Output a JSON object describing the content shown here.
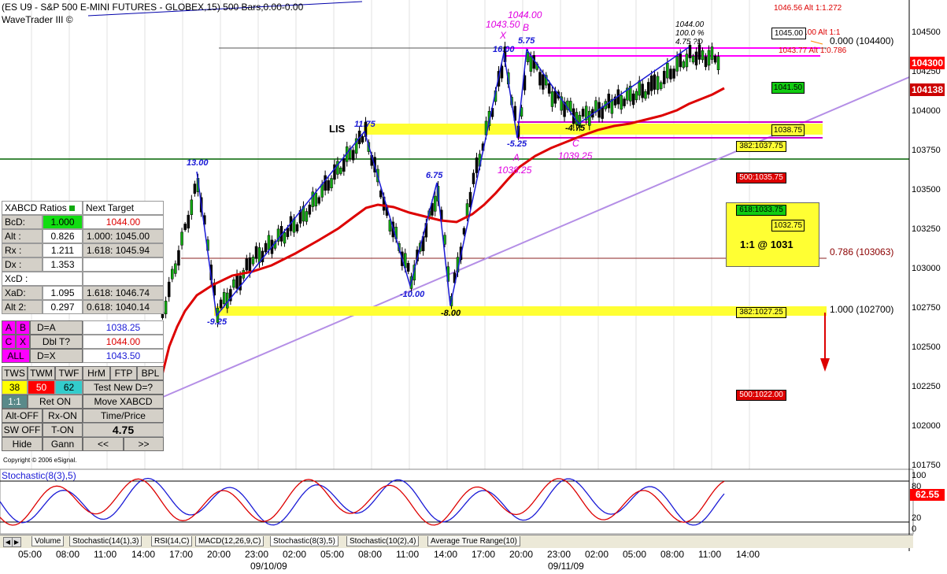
{
  "header": {
    "title": "(ES U9 - S&P 500 E-MINI FUTURES - GLOBEX,15) 500 Bars,0.00-0.00",
    "app": "WaveTrader III ©"
  },
  "copyright": "Copyright © 2006 eSignal.",
  "price_axis": {
    "ticks": [
      "104500",
      "104250",
      "104000",
      "103750",
      "103500",
      "103250",
      "103000",
      "102750",
      "102500",
      "102250",
      "102000",
      "101750"
    ],
    "current_price_badge": "104300",
    "secondary_badge": "104138",
    "current_color": "#ff0000",
    "secondary_color": "#cc0000"
  },
  "stoch_axis": {
    "ticks": [
      "100",
      "80",
      "20",
      "0"
    ],
    "value_badge": "62.55"
  },
  "time_axis": {
    "ticks": [
      "05:00",
      "08:00",
      "11:00",
      "14:00",
      "17:00",
      "20:00",
      "23:00",
      "02:00",
      "05:00",
      "08:00",
      "11:00",
      "14:00",
      "17:00",
      "20:00",
      "23:00",
      "02:00",
      "05:00",
      "08:00",
      "11:00",
      "14:00"
    ],
    "dates": [
      "09/10/09",
      "09/11/09"
    ]
  },
  "indicator_title": "Stochastic(8(3),5)",
  "chart_annotations": {
    "lis": "LIS",
    "swing_labels": [
      "13.00",
      "-9.25",
      "11.75",
      "6.75",
      "-10.00",
      "-8.00",
      "16.00",
      "-5.25",
      "5.75",
      "-4.75"
    ],
    "pattern_letters": {
      "x": "X",
      "a": "A",
      "b": "B",
      "c": "C"
    },
    "pattern_values": {
      "x": "1043.50",
      "a": "1038.25",
      "b": "1044.00",
      "c": "1039.25"
    },
    "top_right_info": [
      "1044.00",
      "100.0 %",
      "4.75 ?D"
    ],
    "levels": {
      "alt1272": "1046.56 Alt 1:1.272",
      "alt11": ".00 Alt 1:1",
      "alt0786": "1043.77 Alt 1:0.786",
      "target1045": "1045.00",
      "zero_line": "0.000 (104400)",
      "g104150": "1041.50",
      "y103875": "1038.75",
      "f382a": "382:1037.75",
      "r500a": "500:1035.75",
      "f618": "618:1033.75",
      "y103275": "1032.75",
      "big_box": "1:1 @ 1031",
      "l0786": "0.786 (103063)",
      "f382b": "382:1027.25",
      "l1000": "1.000 (102700)",
      "r500b": "500:1022.00"
    }
  },
  "tabs": [
    "Volume",
    "Stochastic(14(1),3)",
    "RSI(14,C)",
    "MACD(12,26,9,C)",
    "Stochastic(8(3),5)",
    "Stochastic(10(2),4)",
    "Average True Range(10)"
  ],
  "panel": {
    "header_left": "XABCD Ratios",
    "header_right": "Next Target",
    "rows": [
      {
        "label": "BcD:",
        "value": "1.000",
        "extra": "1044.00"
      },
      {
        "label": "Alt  :",
        "value": "0.826",
        "extra": "1.000: 1045.00"
      },
      {
        "label": "Rx   :",
        "value": "1.211",
        "extra": "1.618: 1045.94"
      },
      {
        "label": "Dx   :",
        "value": "1.353",
        "extra": ""
      },
      {
        "label": "XcD :",
        "value": "",
        "extra": ""
      },
      {
        "label": "XaD:",
        "value": "1.095",
        "extra": "1.618: 1046.74"
      },
      {
        "label": "Alt 2:",
        "value": "0.297",
        "extra": "0.618: 1040.14"
      }
    ],
    "da_row": {
      "a": "A",
      "b": "B",
      "label": "D=A",
      "value": "1038.25"
    },
    "dbl_row": {
      "c": "C",
      "x": "X",
      "label": "Dbl T?",
      "value": "1044.00"
    },
    "all_row": {
      "all": "ALL",
      "label": "D=X",
      "value": "1043.50"
    },
    "row9": [
      "TWS",
      "TWM",
      "TWF",
      "HrM",
      "FTP",
      "BPL"
    ],
    "row10": {
      "a": "38",
      "b": "50",
      "c": "62",
      "d": "Test New D=?"
    },
    "row11": {
      "a": "1:1",
      "b": "Ret ON",
      "c": "Move XABCD"
    },
    "row12": {
      "a": "Alt-OFF",
      "b": "Rx-ON",
      "c": "Time/Price"
    },
    "row13": {
      "a": "SW OFF",
      "b": "T-ON",
      "c": "4.75"
    },
    "row14": {
      "a": "Hide",
      "b": "Gann",
      "c": "<<",
      "d": ">>"
    },
    "colors": {
      "tws": "#ffff00",
      "twm": "#ff0000",
      "twf": "#33cccc",
      "ab": "#ff00ff"
    }
  }
}
